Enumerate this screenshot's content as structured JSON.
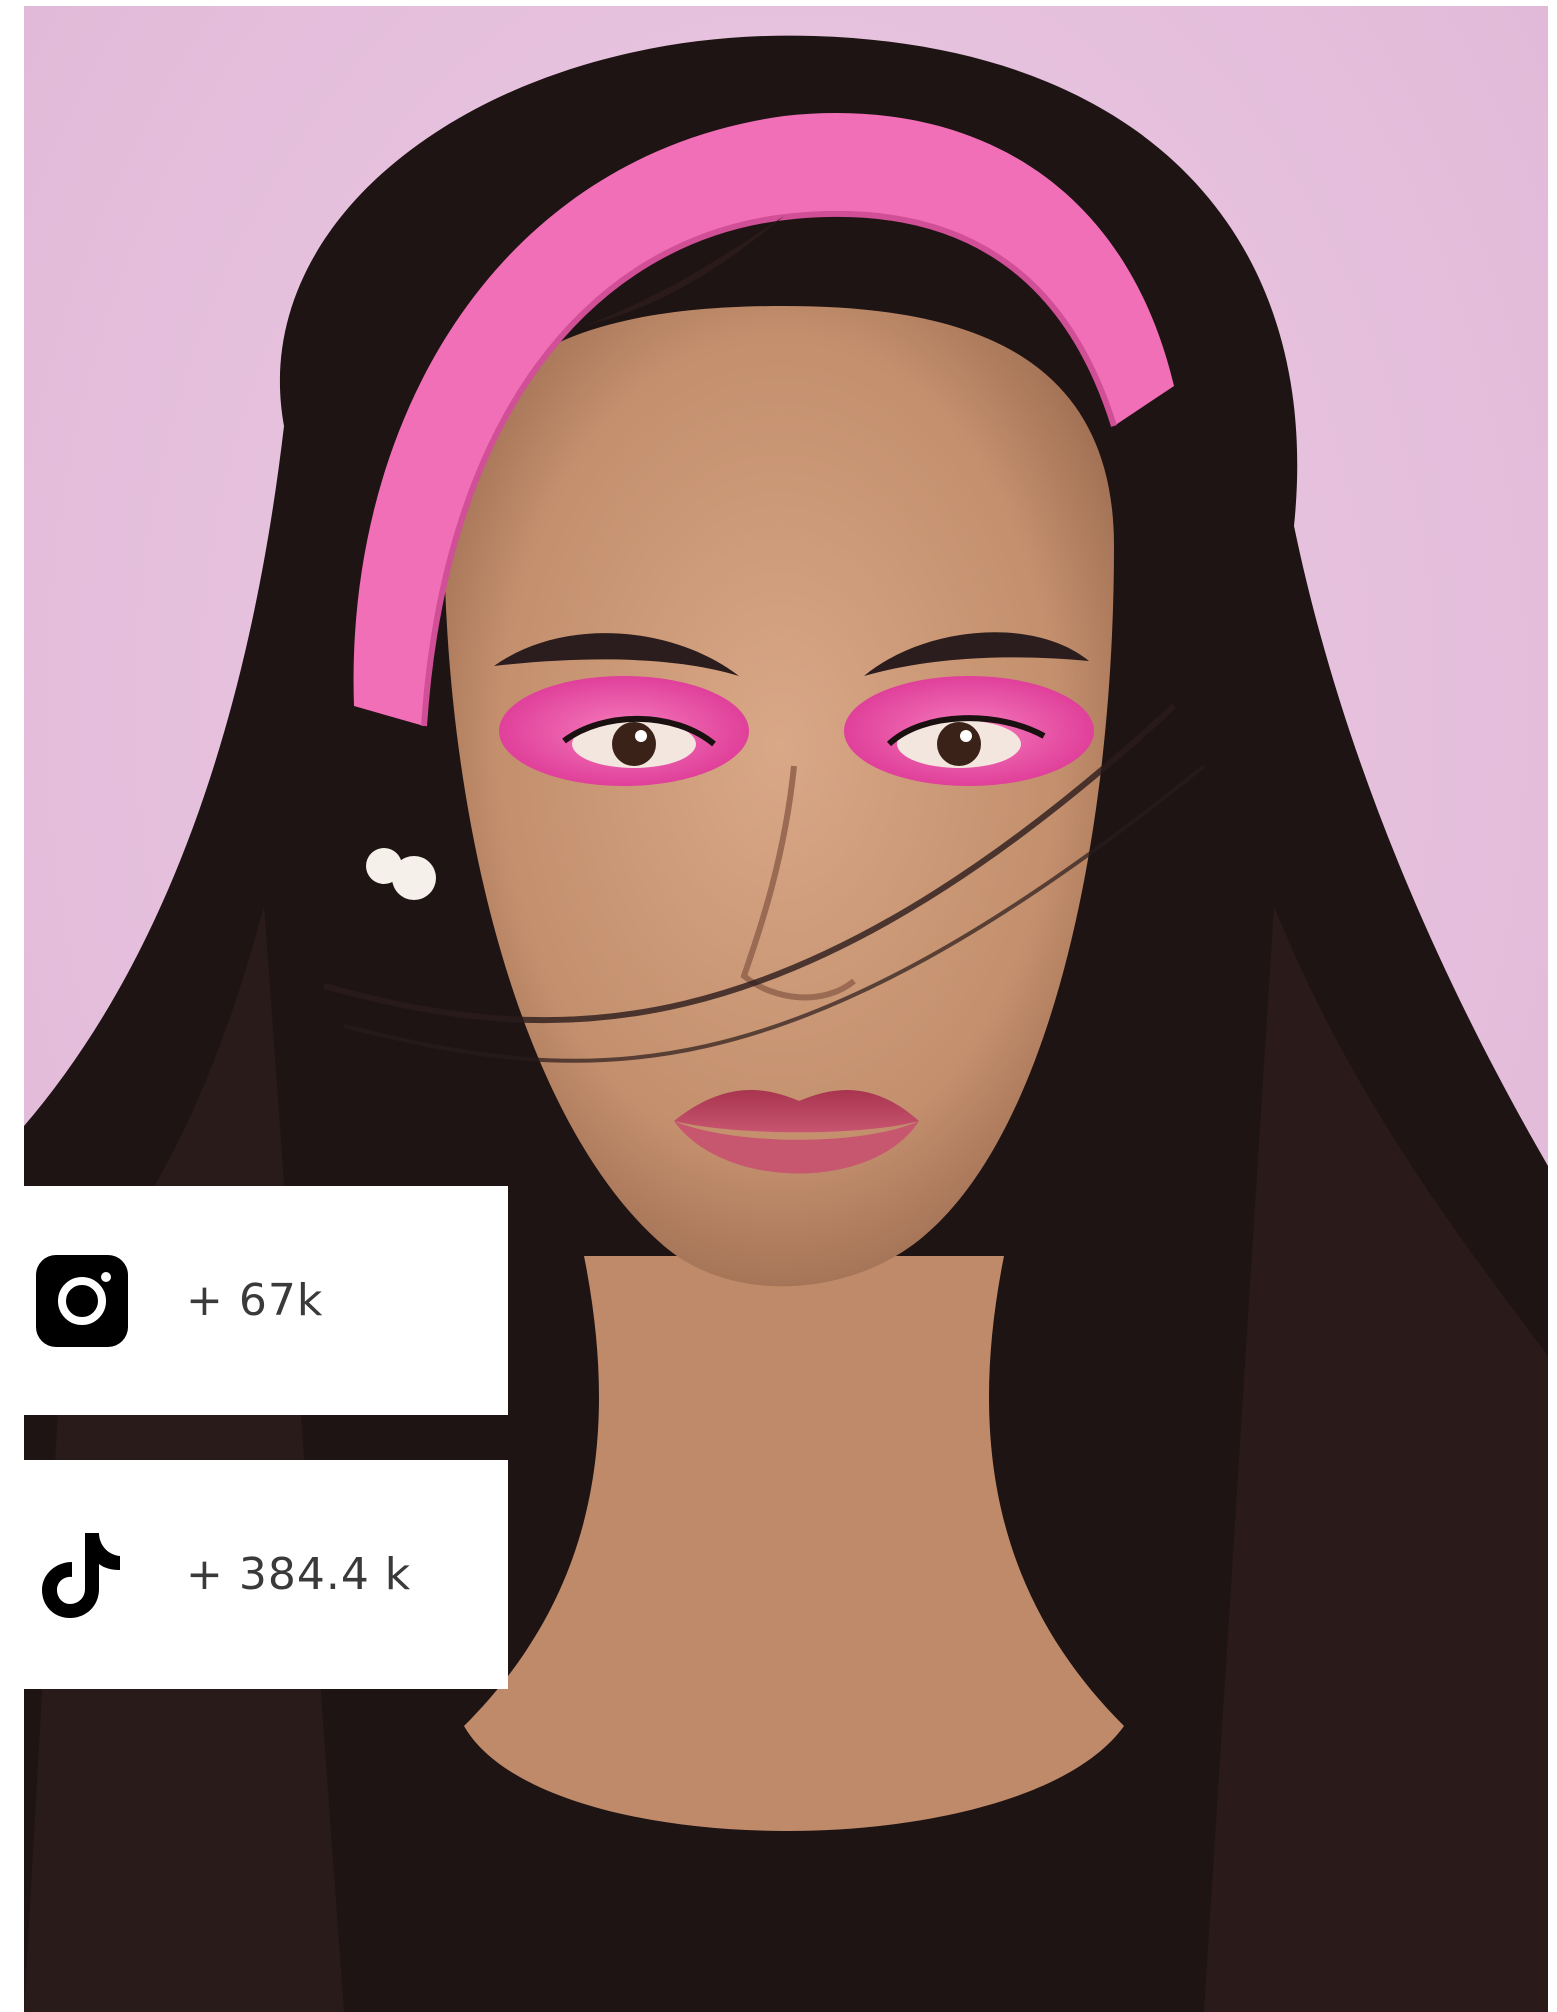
{
  "profile_photo": {
    "background_color": "#e7c3de",
    "headband_color": "#f16fb6",
    "hair_color": "#1f1414",
    "skin_color": "#c99877",
    "eyeshadow_color": "#f05aa6",
    "lip_color": "#b8405c"
  },
  "stats": [
    {
      "platform_icon": "instagram-icon",
      "value": "+ 67k"
    },
    {
      "platform_icon": "tiktok-icon",
      "value": "+ 384.4 k"
    }
  ]
}
